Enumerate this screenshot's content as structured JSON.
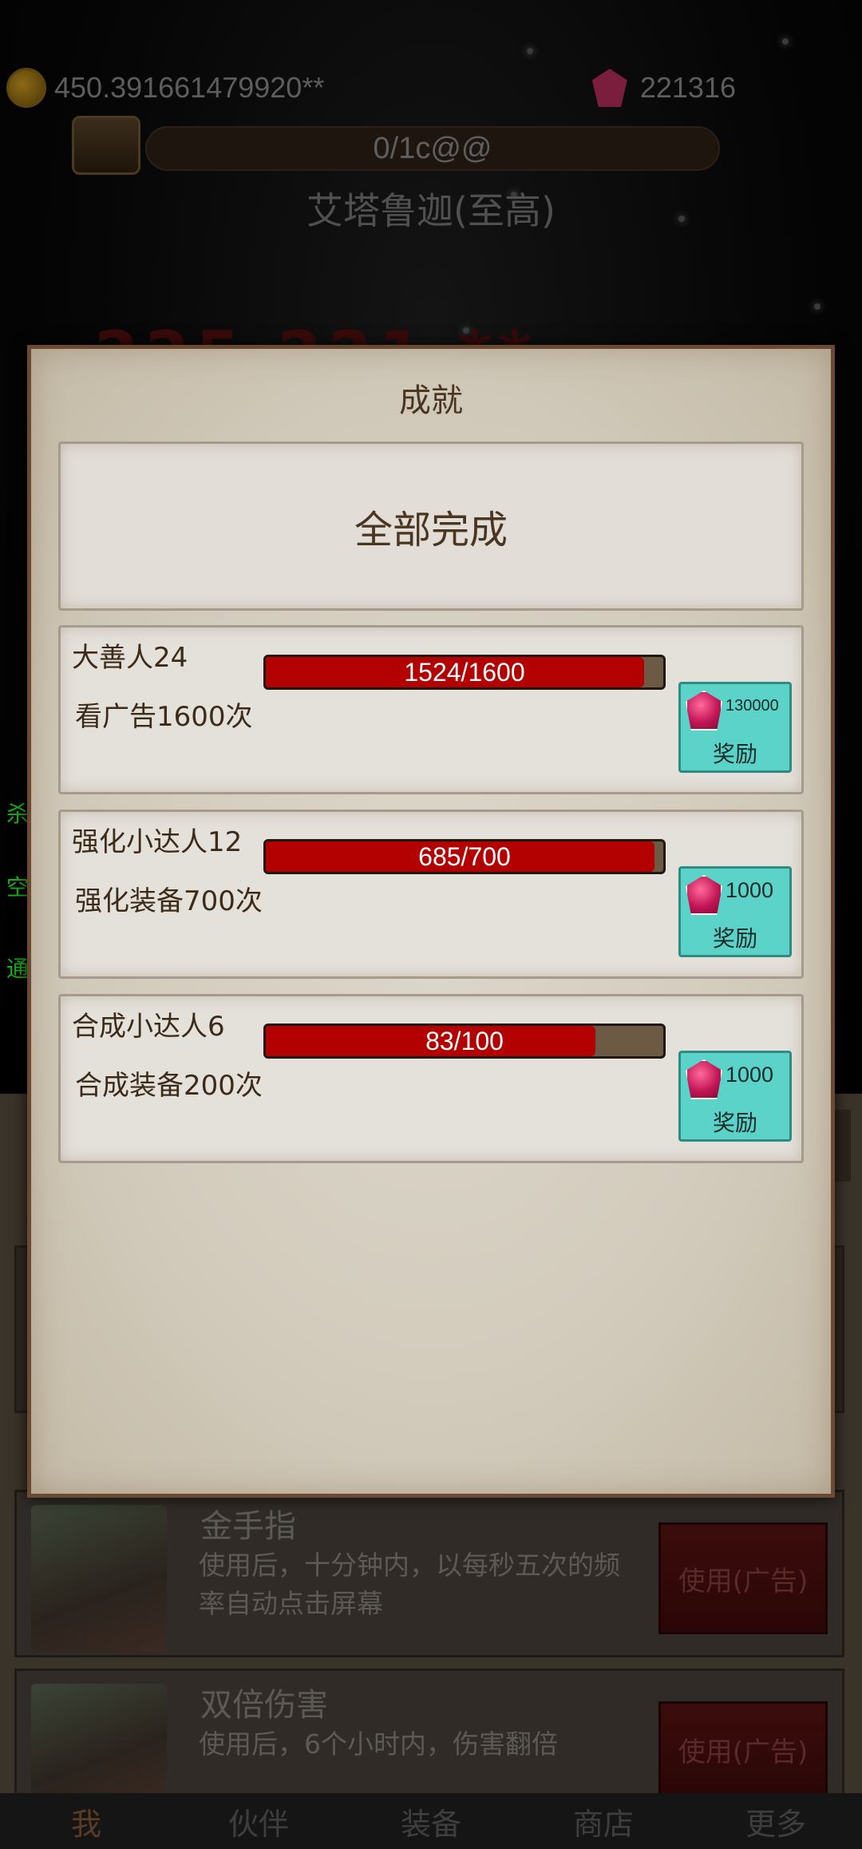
{
  "resources": {
    "gold": "450.391661479920**",
    "gems": "221316"
  },
  "stage": {
    "progress_text": "0/1c@@",
    "boss_name": "艾塔鲁迦(至高)",
    "damage_text": "225.221 **"
  },
  "side_labels": [
    "杀",
    "空",
    "通"
  ],
  "modal": {
    "title": "成就",
    "all_done_label": "全部完成",
    "achievements": [
      {
        "name": "大善人24",
        "desc": "看广告1600次",
        "current": 1524,
        "target": 1600,
        "progress_label": "1524/1600",
        "reward_amount": "130000",
        "reward_label": "奖励"
      },
      {
        "name": "强化小达人12",
        "desc": "强化装备700次",
        "current": 685,
        "target": 700,
        "progress_label": "685/700",
        "reward_amount": "1000",
        "reward_label": "奖励"
      },
      {
        "name": "合成小达人6",
        "desc": "合成装备200次",
        "current": 83,
        "target": 100,
        "progress_label": "83/100",
        "reward_amount": "1000",
        "reward_label": "奖励"
      }
    ]
  },
  "items": [
    {
      "title": "金手指",
      "desc": "使用后，十分钟内，以每秒五次的频率自动点击屏幕",
      "button": "使用(广告)"
    },
    {
      "title": "双倍伤害",
      "desc": "使用后，6个小时内，伤害翻倍",
      "button": "使用(广告)"
    }
  ],
  "nav": [
    "我",
    "伙伴",
    "装备",
    "商店",
    "更多"
  ],
  "colors": {
    "progress_fill": "#b30000",
    "reward_button": "#5bd3c9",
    "modal_border": "#6b4a33"
  }
}
